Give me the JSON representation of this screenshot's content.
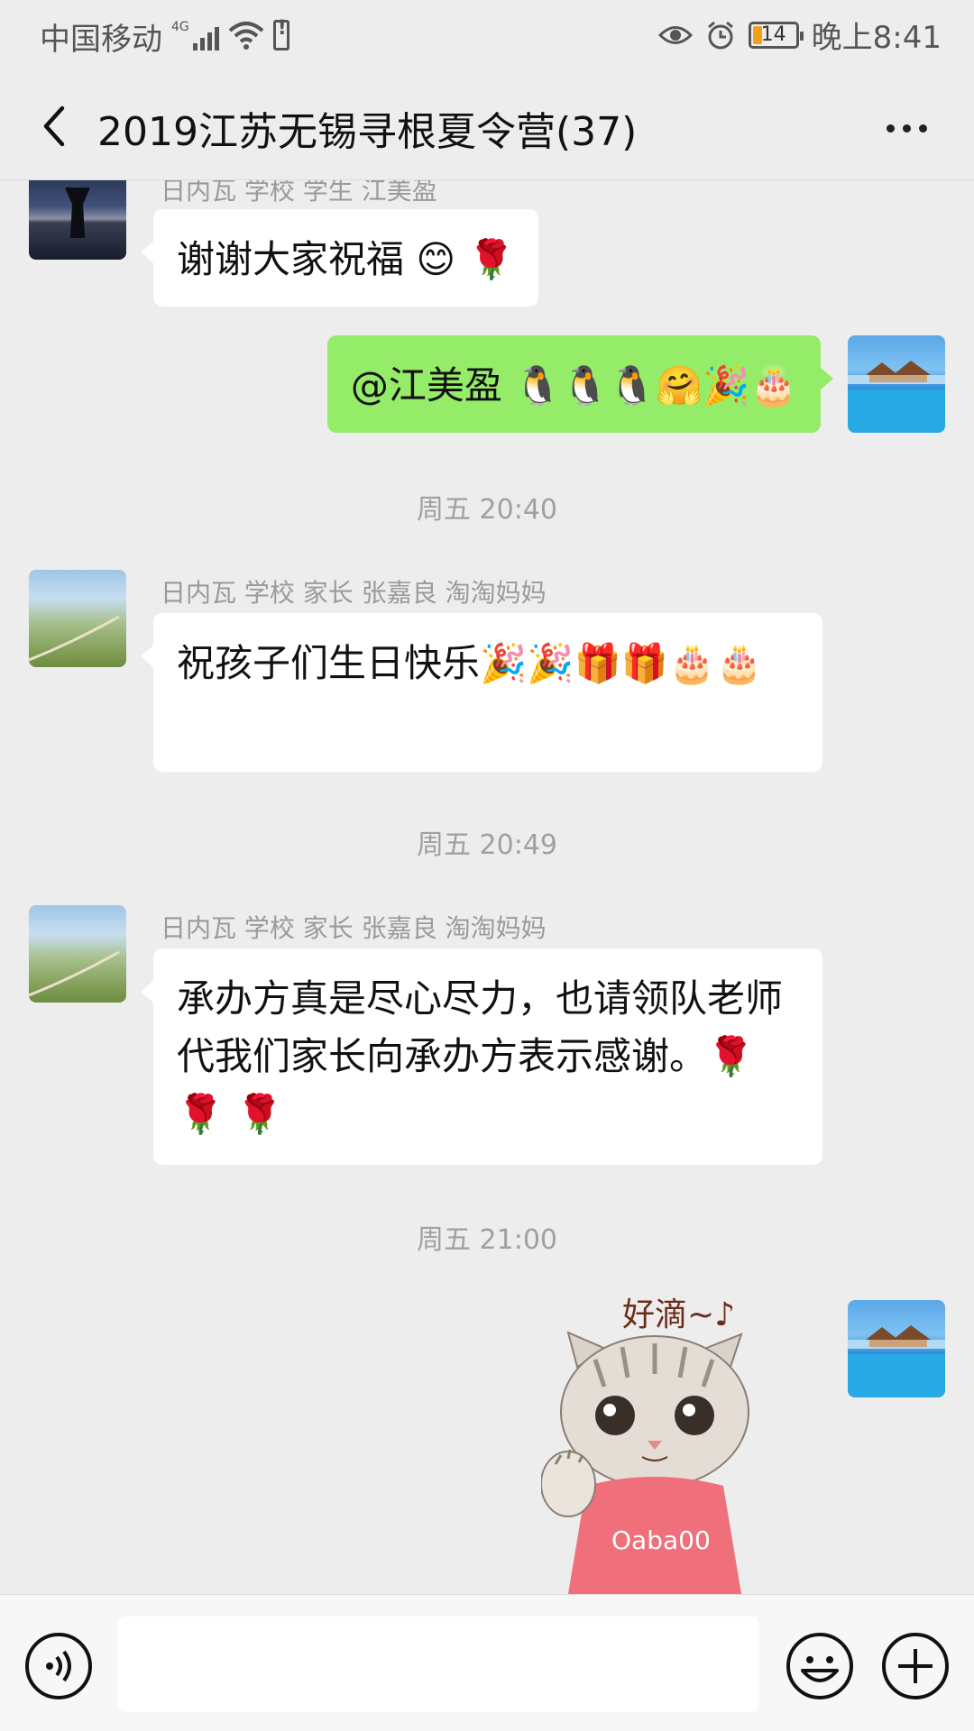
{
  "status_bar": {
    "carrier": "中国移动",
    "network": "4G",
    "battery": "14",
    "time": "晚上8:41"
  },
  "header": {
    "title": "2019江苏无锡寻根夏令营(37)",
    "back_icon": "chevron-left-icon",
    "more_icon": "more-dots-icon"
  },
  "messages": [
    {
      "sender": "日内瓦 学校 学生 江美盈",
      "text": "谢谢大家祝福 😊 🌹"
    },
    {
      "text": "@江美盈 🐧🐧🐧🤗🎉🎂"
    },
    {
      "timestamp": "周五 20:40"
    },
    {
      "sender": "日内瓦 学校 家长 张嘉良 淘淘妈妈",
      "text": "祝孩子们生日快乐🎉🎉🎁🎁🎂🎂"
    },
    {
      "timestamp": "周五 20:49"
    },
    {
      "sender": "日内瓦 学校 家长 张嘉良 淘淘妈妈",
      "text": "承办方真是尽心尽力，也请领队老师代我们家长向承办方表示感谢。🌹 🌹 🌹"
    },
    {
      "timestamp": "周五 21:00"
    },
    {
      "sticker_text": "好滴~♪",
      "sticker_shirt": "Oaba00"
    }
  ],
  "composer": {
    "voice_icon": "voice-icon",
    "emoji_icon": "emoji-icon",
    "plus_icon": "plus-icon",
    "input_value": ""
  }
}
